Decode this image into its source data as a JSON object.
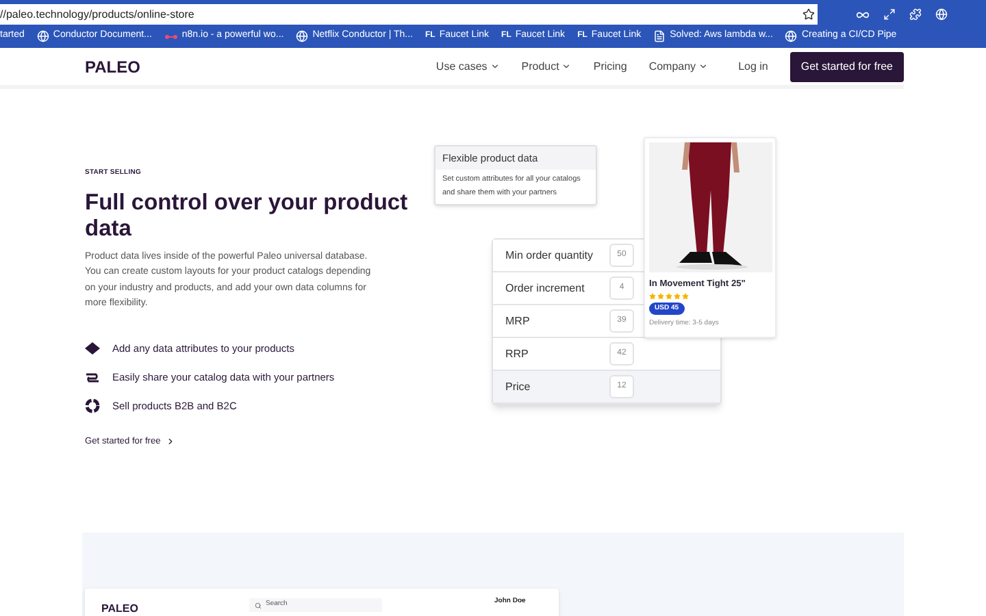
{
  "browser": {
    "url": "//paleo.technology/products/online-store",
    "bookmarks": [
      {
        "label": "tarted"
      },
      {
        "label": "Conductor Document..."
      },
      {
        "label": "n8n.io - a powerful wo..."
      },
      {
        "label": "Netflix Conductor | Th..."
      },
      {
        "label": "Faucet Link",
        "favicon_text": "FL"
      },
      {
        "label": "Faucet Link",
        "favicon_text": "FL"
      },
      {
        "label": "Faucet Link",
        "favicon_text": "FL"
      },
      {
        "label": "Solved: Aws lambda w..."
      },
      {
        "label": "Creating a CI/CD Pipe"
      }
    ]
  },
  "nav": {
    "logo": "PALEO",
    "items": [
      {
        "label": "Use cases",
        "dropdown": true
      },
      {
        "label": "Product",
        "dropdown": true
      },
      {
        "label": "Pricing",
        "dropdown": false
      },
      {
        "label": "Company",
        "dropdown": true
      }
    ],
    "login": "Log in",
    "cta": "Get started for free"
  },
  "hero": {
    "eyebrow": "START SELLING",
    "title": "Full control over your product data",
    "body": "Product data lives inside of the powerful Paleo universal database. You can create custom layouts for your product catalogs depending on your industry and products, and add your own data columns for more flexibility.",
    "features": [
      {
        "text": "Add any data attributes to your products"
      },
      {
        "text": "Easily share your catalog data with your partners"
      },
      {
        "text": "Sell products B2B and B2C"
      }
    ],
    "link": "Get started for free"
  },
  "tooltip": {
    "title": "Flexible product data",
    "body": "Set custom attributes for all your catalogs and share them with your partners"
  },
  "attributes": [
    {
      "label": "Min order quantity",
      "value": "50",
      "selected": false
    },
    {
      "label": "Order increment",
      "value": "4",
      "selected": false
    },
    {
      "label": "MRP",
      "value": "39",
      "selected": false
    },
    {
      "label": "RRP",
      "value": "42",
      "selected": false
    },
    {
      "label": "Price",
      "value": "12",
      "selected": true
    }
  ],
  "product": {
    "name": "In Movement Tight 25\"",
    "stars": 5,
    "price": "USD 45",
    "delivery": "Delivery time: 3-5 days"
  },
  "preview": {
    "logo": "PALEO",
    "search": {
      "placeholder": "Search"
    },
    "user": "John Doe"
  }
}
